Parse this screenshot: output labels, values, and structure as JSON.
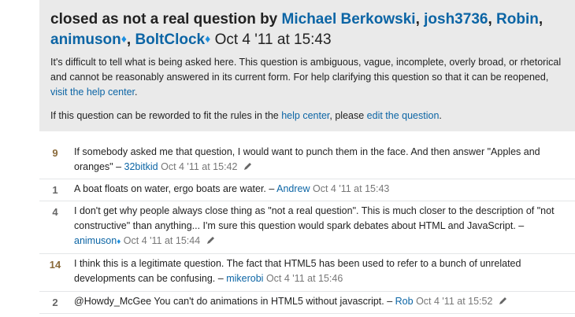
{
  "notice": {
    "prefix": "closed as not a real question by",
    "voters": [
      "Michael Berkowski",
      "josh3736",
      "Robin",
      "animuson",
      "BoltClock"
    ],
    "diamond": "♦",
    "date": "Oct 4 '11 at 15:43",
    "body_text": "It's difficult to tell what is being asked here. This question is ambiguous, vague, incomplete, overly broad, or rhetorical and cannot be reasonably answered in its current form. For help clarifying this question so that it can be reopened, ",
    "body_link": "visit the help center",
    "reword_text": "If this question can be reworded to fit the rules in the ",
    "reword_link1": "help center",
    "reword_mid": ", please ",
    "reword_link2": "edit the question",
    "period": "."
  },
  "comments": [
    {
      "score": "9",
      "text": "If somebody asked me that question, I would want to punch them in the face. And then answer \"Apples and oranges\"",
      "user": "32bitkid",
      "date": "Oct 4 '11 at 15:42"
    },
    {
      "score": "1",
      "text": "A boat floats on water, ergo boats are water.",
      "user": "Andrew",
      "date": "Oct 4 '11 at 15:43"
    },
    {
      "score": "4",
      "text": "I don't get why people always close thing as \"not a real question\". This is much closer to the description of \"not constructive\" than anything... I'm sure this question would spark debates about HTML and JavaScript.",
      "user": "animuson",
      "date": "Oct 4 '11 at 15:44"
    },
    {
      "score": "14",
      "text": "I think this is a legitimate question. The fact that HTML5 has been used to refer to a bunch of unrelated developments can be confusing.",
      "user": "mikerobi",
      "date": "Oct 4 '11 at 15:46"
    },
    {
      "score": "2",
      "text": "@Howdy_McGee You can't do animations in HTML5 without javascript.",
      "user": "Rob",
      "date": "Oct 4 '11 at 15:52"
    }
  ],
  "sep": " – ",
  "comma": ", ",
  "diamond": "♦"
}
